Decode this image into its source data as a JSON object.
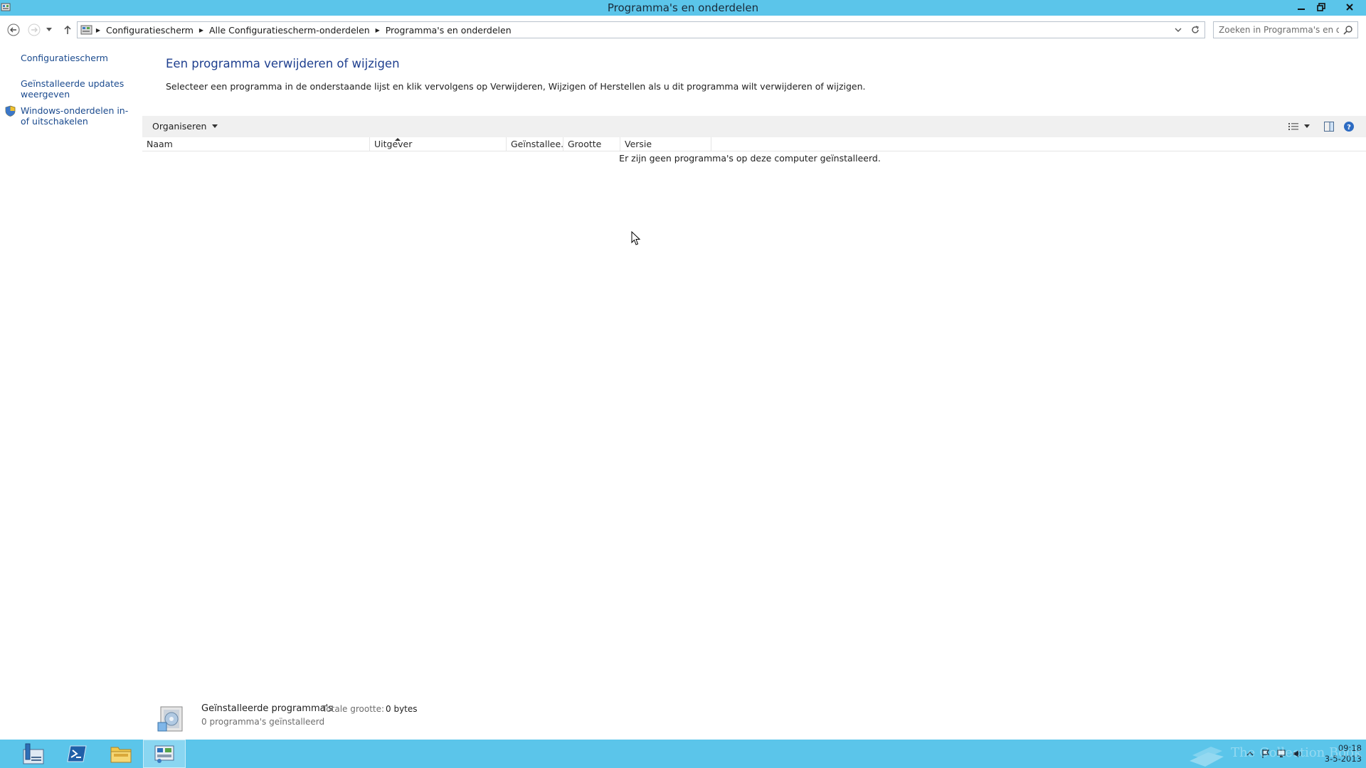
{
  "window": {
    "title": "Programma's en onderdelen"
  },
  "address_bar": {
    "breadcrumbs": [
      "Configuratiescherm",
      "Alle Configuratiescherm-onderdelen",
      "Programma's en onderdelen"
    ],
    "search_placeholder": "Zoeken in Programma's en o..."
  },
  "left_pane": {
    "links": [
      "Configuratiescherm",
      "Geïnstalleerde updates weergeven",
      "Windows-onderdelen in- of uitschakelen"
    ]
  },
  "main": {
    "heading": "Een programma verwijderen of wijzigen",
    "description": "Selecteer een programma in de onderstaande lijst en klik vervolgens op Verwijderen, Wijzigen of Herstellen als u dit programma wilt verwijderen of wijzigen.",
    "toolbar": {
      "organize_label": "Organiseren"
    },
    "columns": [
      "Naam",
      "Uitgever",
      "Geïnstallee...",
      "Grootte",
      "Versie"
    ],
    "empty_message": "Er zijn geen programma's op deze computer geïnstalleerd."
  },
  "details_pane": {
    "title": "Geïnstalleerde programma's",
    "total_size_label": "Totale grootte:",
    "total_size_value": "0 bytes",
    "count_text": "0 programma's geïnstalleerd"
  },
  "taskbar": {
    "clock_time": "09:18",
    "clock_date": "3-5-2013",
    "watermark_text": "The Collection Book"
  },
  "icons": {
    "app": "control-panel-icon",
    "back": "arrow-left-icon",
    "forward": "arrow-right-icon",
    "up": "arrow-up-icon",
    "refresh": "refresh-icon",
    "search": "magnifier-icon",
    "shield": "uac-shield-icon",
    "view": "view-details-icon",
    "preview_pane": "preview-pane-icon",
    "help": "help-icon"
  },
  "colors": {
    "accent": "#5bc5ea",
    "link": "#1a4a8e",
    "heading": "#1e3f8f"
  }
}
